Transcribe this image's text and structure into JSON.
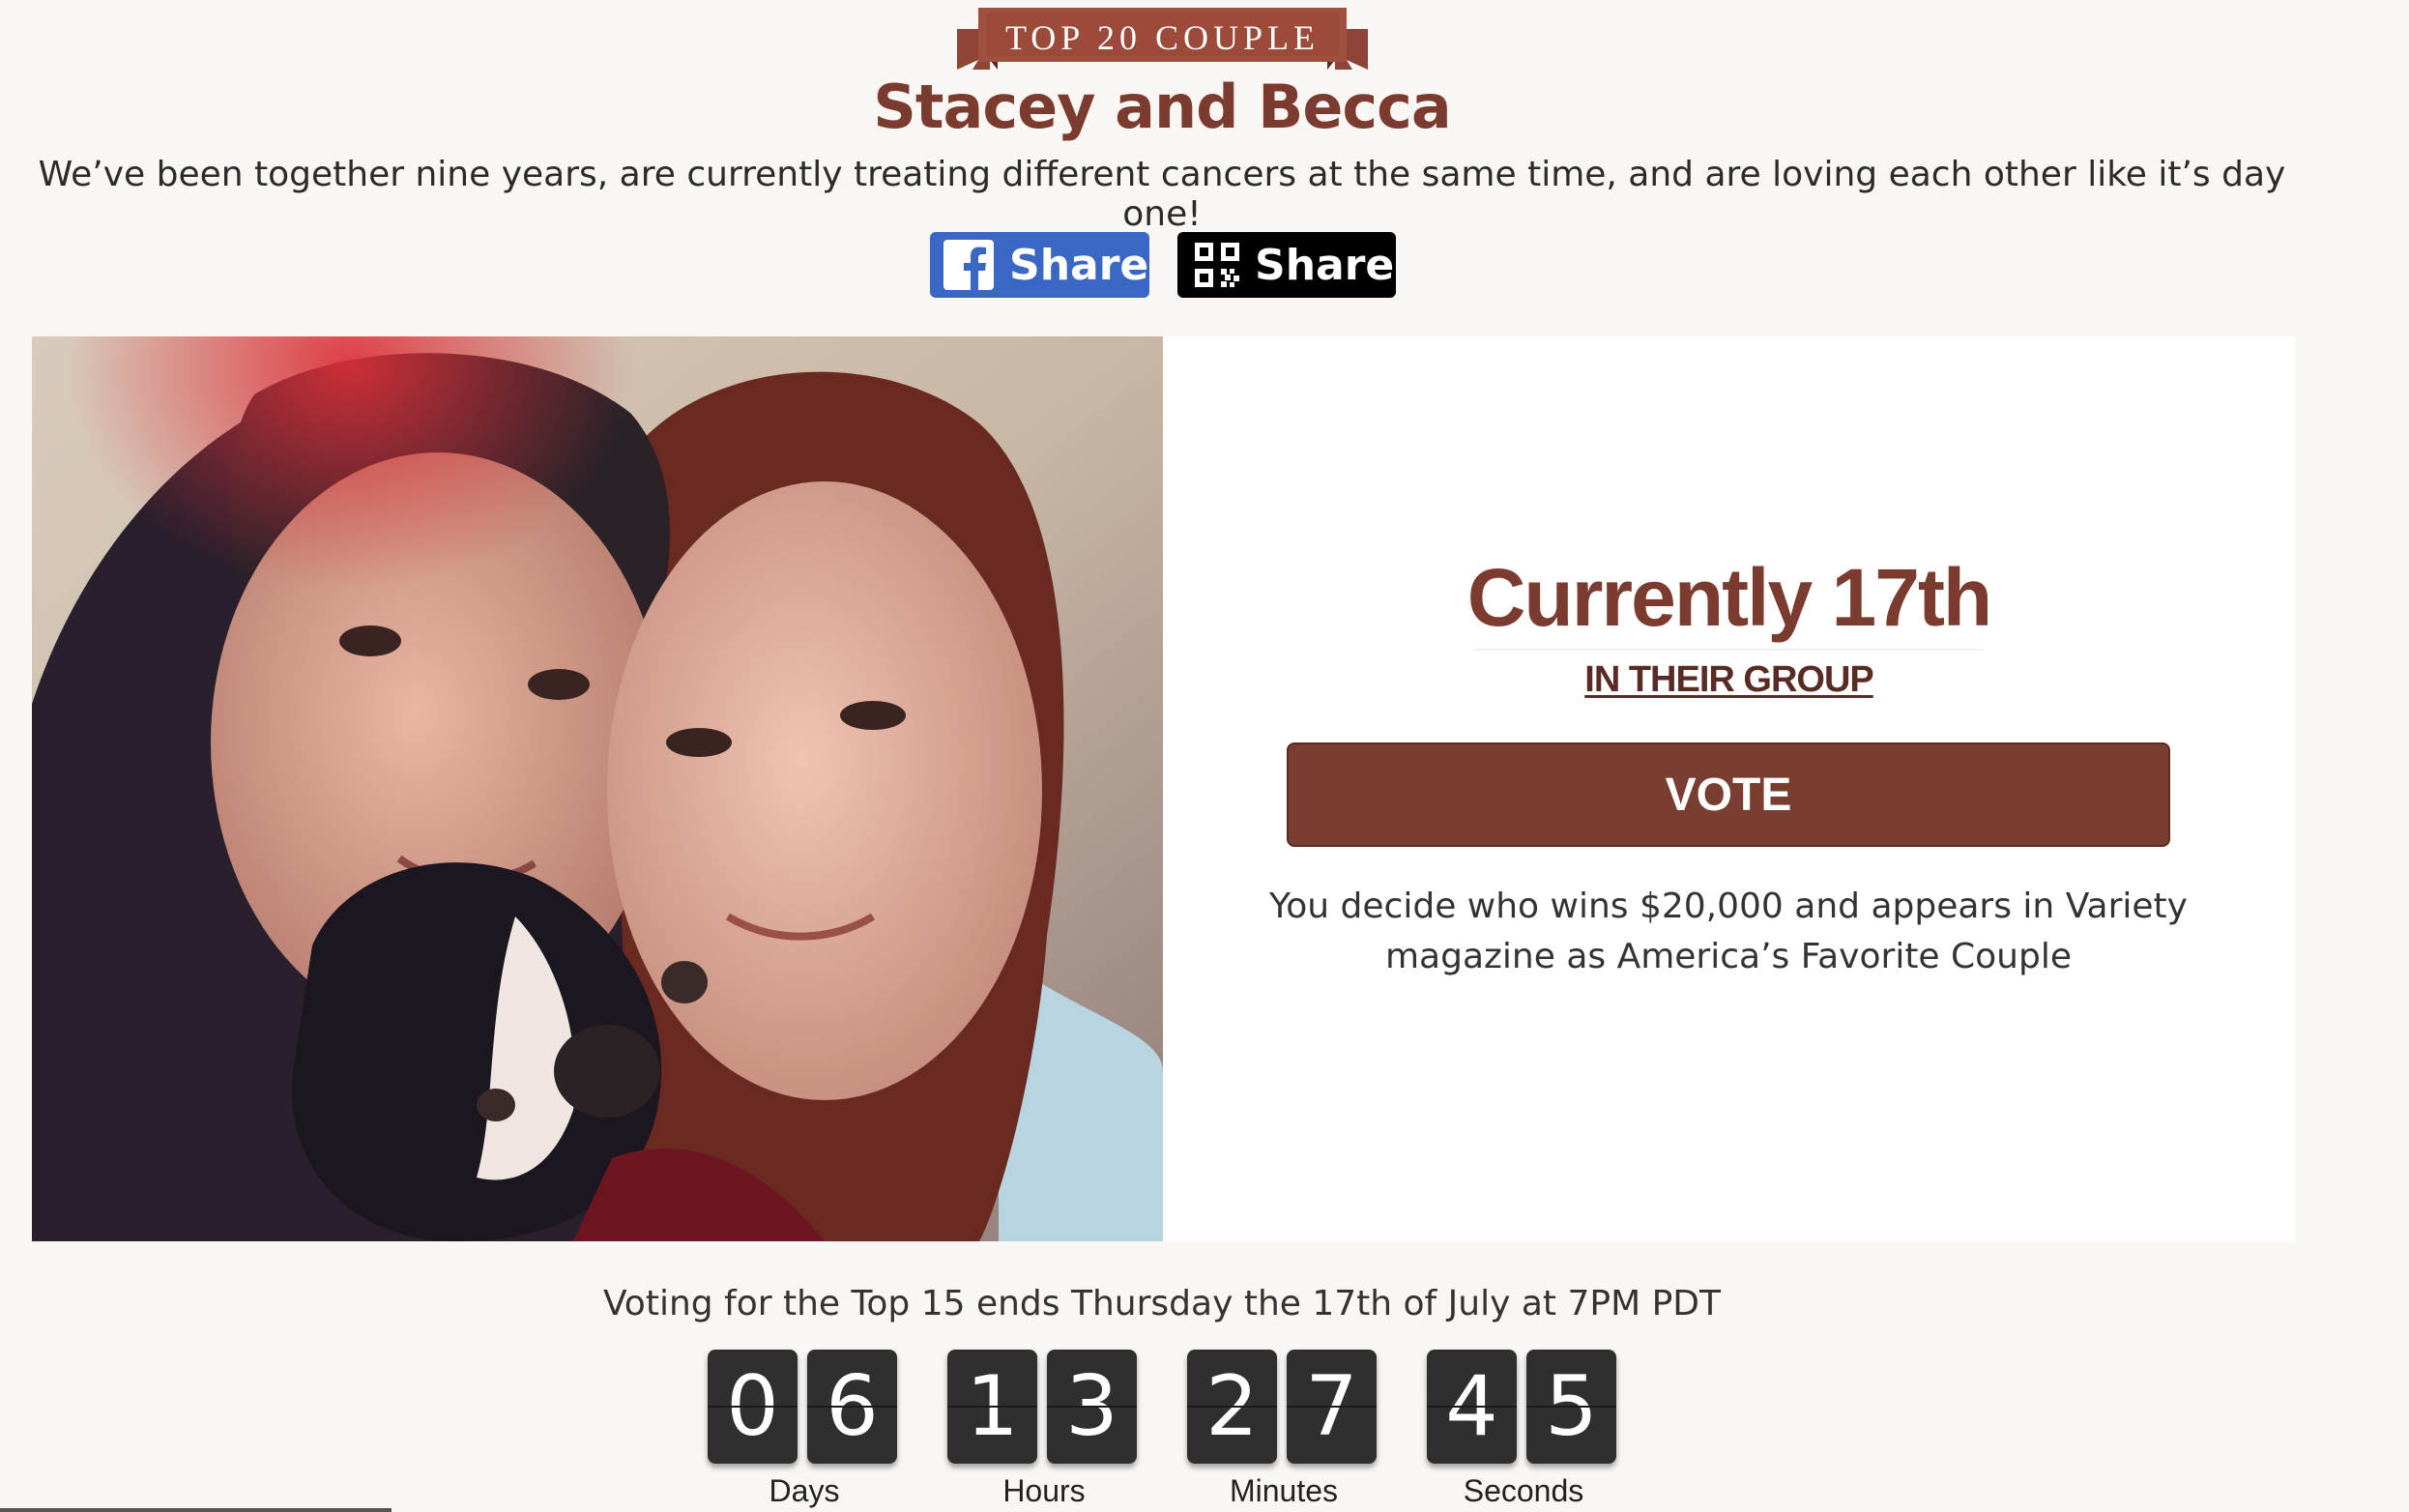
{
  "banner": {
    "ribbon_text": "TOP 20 COUPLE",
    "couple_name": "Stacey and Becca",
    "tagline": "We’ve been together nine years, are currently treating different cancers at the same time, and are loving each other like it’s day one!"
  },
  "share": {
    "facebook_label": "Share",
    "qr_label": "Share"
  },
  "card": {
    "rank": "Currently 17th",
    "group_link": "IN THEIR GROUP",
    "vote_label": "VOTE",
    "vote_description": "You decide who wins $20,000 and appears in Variety magazine as America’s Favorite Couple"
  },
  "countdown": {
    "note": "Voting for the Top 15 ends Thursday the 17th of July at 7PM PDT",
    "units": [
      {
        "digits": [
          "0",
          "6"
        ],
        "label": "Days"
      },
      {
        "digits": [
          "1",
          "3"
        ],
        "label": "Hours"
      },
      {
        "digits": [
          "2",
          "7"
        ],
        "label": "Minutes"
      },
      {
        "digits": [
          "4",
          "5"
        ],
        "label": "Seconds"
      }
    ]
  },
  "colors": {
    "brand_brown": "#7b3b2f",
    "facebook_blue": "#3b67c4",
    "page_background": "#f9f6f3"
  }
}
